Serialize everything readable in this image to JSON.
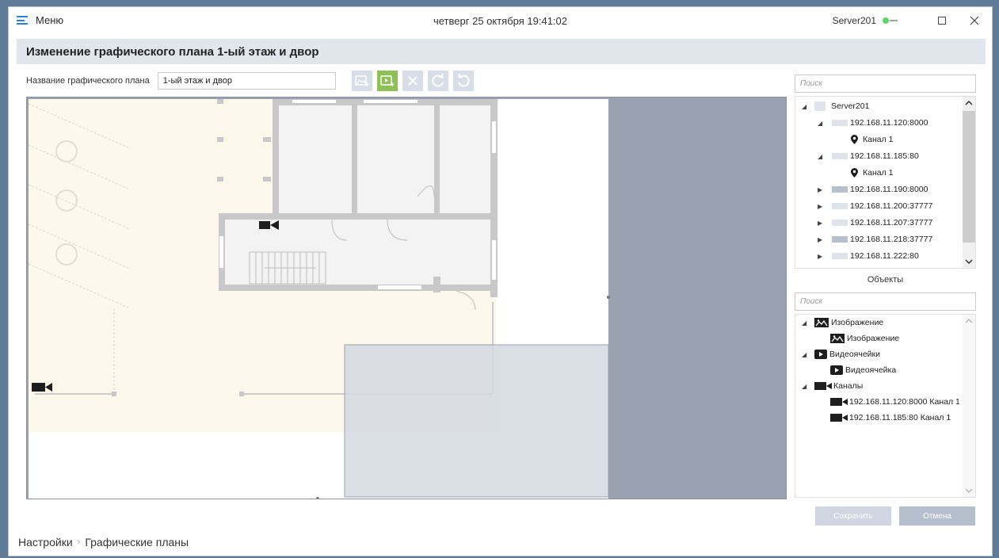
{
  "titlebar": {
    "menu_label": "Меню",
    "datetime": "четверг 25 октября 19:41:02",
    "server_name": "Server201",
    "status_color": "#5ed36b"
  },
  "header": {
    "title": "Изменение графического плана 1-ый этаж и двор"
  },
  "plan_name": {
    "label": "Название графического плана",
    "value": "1-ый этаж и двор"
  },
  "toolbar": {
    "tools": [
      "add-image-icon",
      "add-videocell-icon",
      "delete-icon",
      "redo-icon",
      "undo-icon"
    ],
    "active_color": "#8fc057"
  },
  "server_tree": {
    "search_placeholder": "Поиск",
    "items": [
      {
        "label": "Server201"
      },
      {
        "label": "192.168.11.120:8000"
      },
      {
        "label": "Канал 1"
      },
      {
        "label": "192.168.11.185:80"
      },
      {
        "label": "Канал 1"
      },
      {
        "label": "192.168.11.190:8000"
      },
      {
        "label": "192.168.11.200:37777"
      },
      {
        "label": "192.168.11.207:37777"
      },
      {
        "label": "192.168.11.218:37777"
      },
      {
        "label": "192.168.11.222:80"
      }
    ]
  },
  "objects": {
    "title": "Объекты",
    "search_placeholder": "Поиск",
    "items": [
      {
        "label": "Изображение"
      },
      {
        "label": "Изображение"
      },
      {
        "label": "Видеоячейки"
      },
      {
        "label": "Видеоячейка"
      },
      {
        "label": "Каналы"
      },
      {
        "label": "192.168.11.120:8000 Канал 1"
      },
      {
        "label": "192.168.11.185:80 Канал 1"
      }
    ]
  },
  "buttons": {
    "save": "Сохранить",
    "cancel": "Отмена"
  },
  "breadcrumb": {
    "root": "Настройки",
    "current": "Графические планы"
  }
}
